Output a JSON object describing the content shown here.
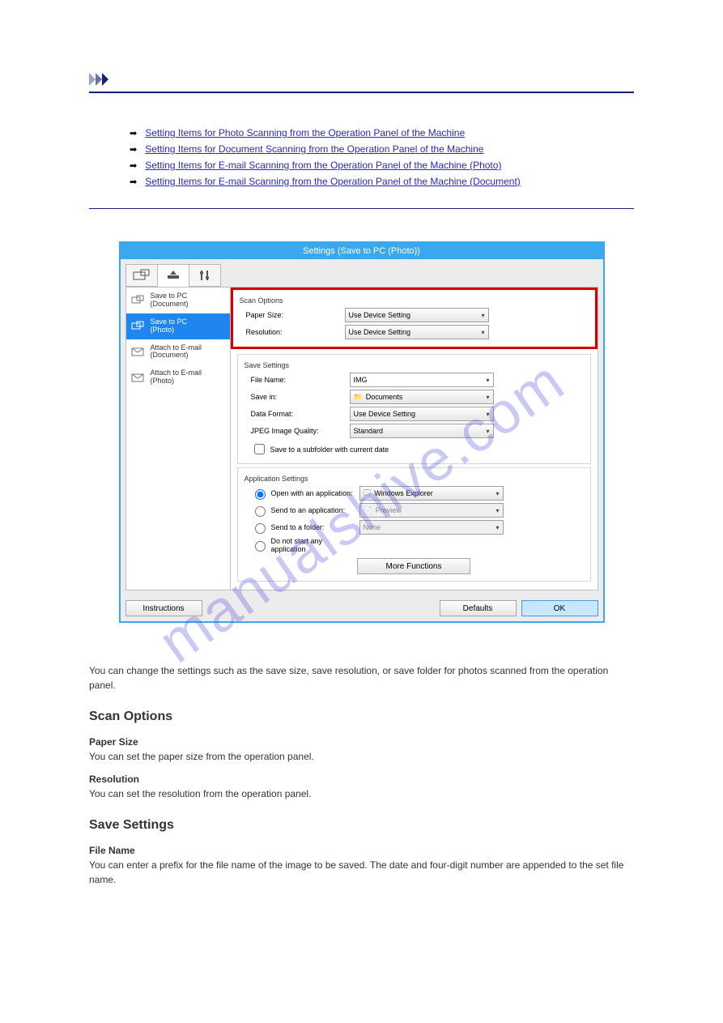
{
  "links": {
    "l1": "Setting Items for Photo Scanning from the Operation Panel of the Machine",
    "l2": "Setting Items for Document Scanning from the Operation Panel of the Machine",
    "l3": "Setting Items for E-mail Scanning from the Operation Panel of the Machine (Photo)",
    "l4": "Setting Items for E-mail Scanning from the Operation Panel of the Machine (Document)"
  },
  "dialog": {
    "title": "Settings (Save to PC (Photo))"
  },
  "sidebar": {
    "items": [
      {
        "top": "Save to PC",
        "bot": "(Document)"
      },
      {
        "top": "Save to PC",
        "bot": "(Photo)"
      },
      {
        "top": "Attach to E-mail",
        "bot": "(Document)"
      },
      {
        "top": "Attach to E-mail",
        "bot": "(Photo)"
      }
    ]
  },
  "scan": {
    "heading": "Scan Options",
    "paper_label": "Paper Size:",
    "paper_value": "Use Device Setting",
    "res_label": "Resolution:",
    "res_value": "Use Device Setting"
  },
  "save": {
    "heading": "Save Settings",
    "fname_label": "File Name:",
    "fname_value": "IMG",
    "savein_label": "Save in:",
    "savein_value": "Documents",
    "format_label": "Data Format:",
    "format_value": "Use Device Setting",
    "jpeg_label": "JPEG Image Quality:",
    "jpeg_value": "Standard",
    "chk_label": "Save to a subfolder with current date"
  },
  "app": {
    "heading": "Application Settings",
    "r1_label": "Open with an application:",
    "r1_value": "Windows Explorer",
    "r2_label": "Send to an application:",
    "r2_value": "Preview",
    "r3_label": "Send to a folder:",
    "r3_value": "None",
    "r4_label": "Do not start any application",
    "more": "More Functions"
  },
  "footer": {
    "instructions": "Instructions",
    "defaults": "Defaults",
    "ok": "OK"
  },
  "watermark": "manualshive.com",
  "desc": {
    "p0": "You can change the settings such as the save size, save resolution, or save folder for photos scanned from the operation panel.",
    "s1h": "Scan Options",
    "s1a_h": "Paper Size",
    "s1a": "You can set the paper size from the operation panel.",
    "s1b_h": "Resolution",
    "s1b": "You can set the resolution from the operation panel.",
    "s2h": "Save Settings",
    "s2a_h": "File Name",
    "s2a": "You can enter a prefix for the file name of the image to be saved. The date and four-digit number are appended to the set file name."
  }
}
